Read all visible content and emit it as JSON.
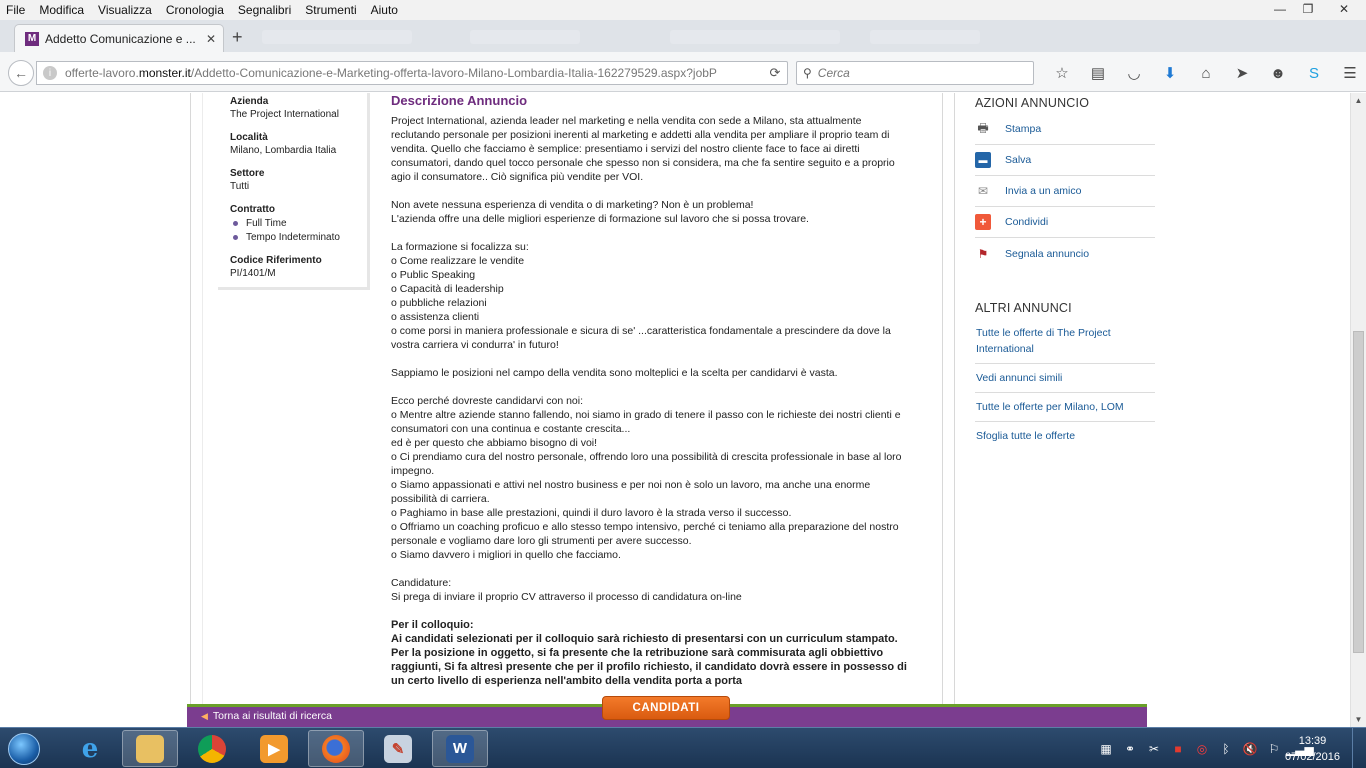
{
  "menubar": {
    "items": [
      "File",
      "Modifica",
      "Visualizza",
      "Cronologia",
      "Segnalibri",
      "Strumenti",
      "Aiuto"
    ]
  },
  "window_controls": {
    "minimize": "—",
    "maximize": "❐",
    "close": "✕"
  },
  "tab": {
    "title": "Addetto Comunicazione e ...",
    "favicon": "M"
  },
  "navbar": {
    "url_prefix": "offerte-lavoro.",
    "url_host": "monster.it",
    "url_path": "/Addetto-Comunicazione-e-Marketing-offerta-lavoro-Milano-Lombardia-Italia-162279529.aspx?jobP",
    "search_placeholder": "Cerca"
  },
  "summary": {
    "azienda_label": "Azienda",
    "azienda_value": "The Project International",
    "localita_label": "Località",
    "localita_value": "Milano, Lombardia Italia",
    "settore_label": "Settore",
    "settore_value": "Tutti",
    "contratto_label": "Contratto",
    "contratto_values": [
      "Full Time",
      "Tempo Indeterminato"
    ],
    "codice_label": "Codice Riferimento",
    "codice_value": "PI/1401/M"
  },
  "description": {
    "title": "Descrizione Annuncio",
    "paragraphs": [
      "Project International, azienda leader nel marketing e nella vendita con sede a Milano, sta attualmente reclutando personale per posizioni inerenti al marketing e addetti alla vendita per ampliare il proprio team di vendita. Quello che facciamo è semplice: presentiamo i servizi del nostro cliente face to face ai diretti consumatori, dando quel tocco personale che spesso non si considera, ma che fa sentire seguito e a proprio agio il consumatore.. Ciò significa più vendite per VOI.",
      "Non avete nessuna esperienza di vendita o di marketing? Non è un problema!\nL'azienda offre una delle migliori esperienze di formazione sul lavoro che si possa trovare.",
      "La formazione si focalizza su:\no Come realizzare le vendite\no Public Speaking\no Capacità di leadership\no pubbliche relazioni\no assistenza clienti\no come porsi in maniera professionale e sicura di se' ...caratteristica fondamentale a prescindere da dove la vostra carriera vi condurra' in futuro!",
      "Sappiamo le posizioni nel campo della vendita sono molteplici e la scelta per candidarvi è vasta.",
      "Ecco perché dovreste candidarvi con noi:\no Mentre altre aziende stanno fallendo, noi siamo in grado di tenere il passo con le richieste dei nostri clienti e consumatori con una continua e costante crescita...\ned è per questo che abbiamo bisogno di voi!\no Ci prendiamo cura del nostro personale, offrendo loro una possibilità di crescita professionale in base al loro impegno.\no Siamo appassionati e attivi nel nostro business e per noi non è solo un lavoro, ma anche una enorme possibilità di carriera.\no Paghiamo in base alle prestazioni, quindi il duro lavoro è la strada verso il successo.\no Offriamo un coaching proficuo e allo stesso tempo intensivo, perché ci teniamo alla preparazione del nostro personale e vogliamo dare loro gli strumenti per avere successo.\no Siamo davvero i migliori in quello che facciamo.",
      "Candidature:\nSi prega di inviare il proprio CV attraverso il processo di candidatura on-line"
    ],
    "bold_paragraph": "Per il colloquio:\nAi candidati selezionati per il colloquio sarà richiesto di presentarsi con  un curriculum stampato. Per la posizione in oggetto, si fa presente che la retribuzione sarà commisurata agli obbiettivo raggiunti, Si fa altresì presente che per il profilo richiesto, il candidato dovrà essere in possesso di un certo livello di esperienza nell'ambito della vendita porta a porta"
  },
  "sidebar": {
    "actions_heading": "AZIONI ANNUNCIO",
    "actions": [
      {
        "label": "Stampa",
        "icon": "printer-icon"
      },
      {
        "label": "Salva",
        "icon": "floppy-icon"
      },
      {
        "label": "Invia a un amico",
        "icon": "envelope-icon"
      },
      {
        "label": "Condividi",
        "icon": "plus-icon"
      },
      {
        "label": "Segnala annuncio",
        "icon": "flag-icon"
      }
    ],
    "others_heading": "ALTRI ANNUNCI",
    "others": [
      "Tutte le offerte di The Project International",
      "Vedi annunci simili",
      "Tutte le offerte per Milano, LOM",
      "Sfoglia tutte le offerte"
    ]
  },
  "bottombar": {
    "back_label": "Torna ai risultati di ricerca",
    "apply_label": "CANDIDATI"
  },
  "taskbar": {
    "time": "13:39",
    "date": "07/02/2016"
  },
  "colors": {
    "brand_purple": "#6e2c7e",
    "link_blue": "#1a5a96",
    "apply_orange": "#e8681c",
    "bar_green": "#6aa02a"
  }
}
